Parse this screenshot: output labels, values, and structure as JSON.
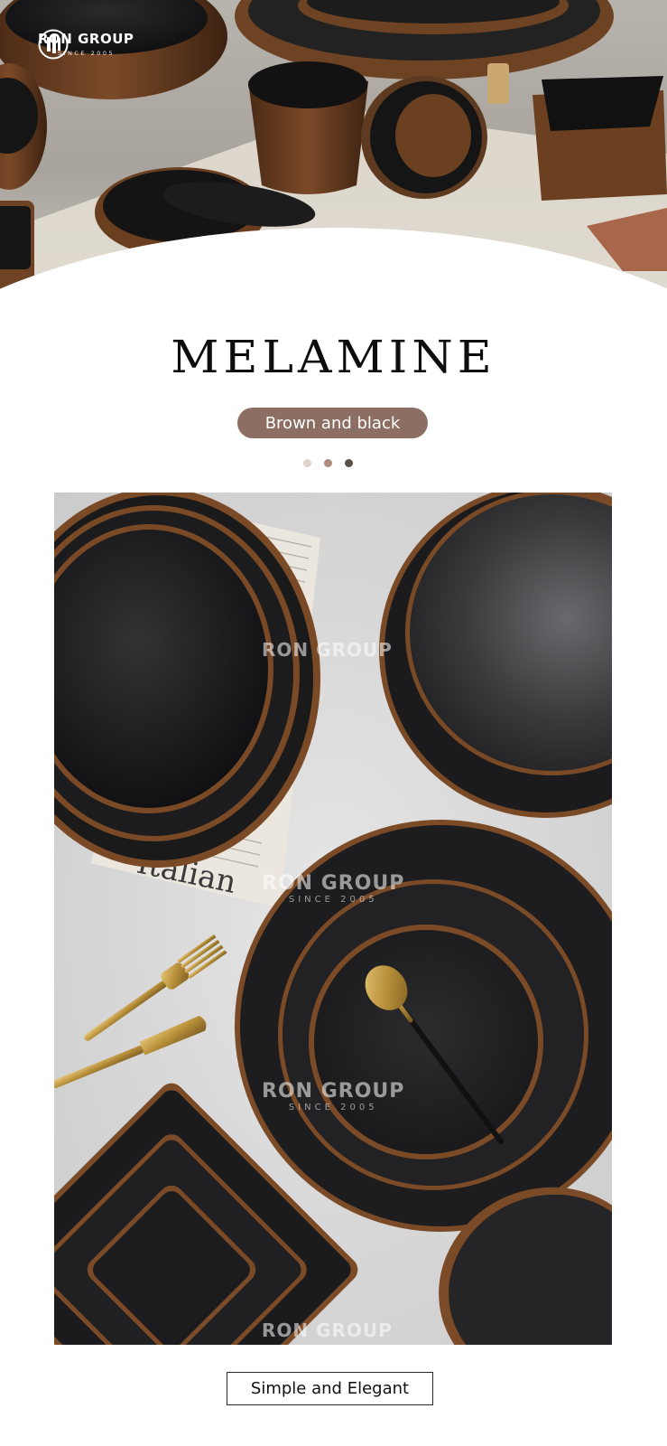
{
  "brand": {
    "name": "RON GROUP",
    "since": "SINCE 2005",
    "logo_icon": "ron-group-monogram-icon"
  },
  "title": "MELAMINE",
  "subtitle_pill": "Brown and black",
  "carousel": {
    "count": 3,
    "active_index": 2
  },
  "photo": {
    "watermarks": [
      {
        "name": "RON GROUP",
        "since": "SINCE 2005"
      },
      {
        "name": "RON GROUP",
        "since": "SINCE 2005"
      },
      {
        "name": "RON GROUP",
        "since": "SINCE 2005"
      },
      {
        "name": "RON GROUP",
        "since": ""
      }
    ],
    "newspaper_text": "Italian"
  },
  "tagline": "Simple and Elegant",
  "colors": {
    "pill_bg": "#8d6e63",
    "dot_light": "#e1d2c9",
    "dot_mid": "#ad8d80",
    "dot_dark": "#5b4f4b",
    "ware_black": "#1d1d1f",
    "ware_rim": "#8a5a33",
    "gold": "#c9a24a"
  }
}
